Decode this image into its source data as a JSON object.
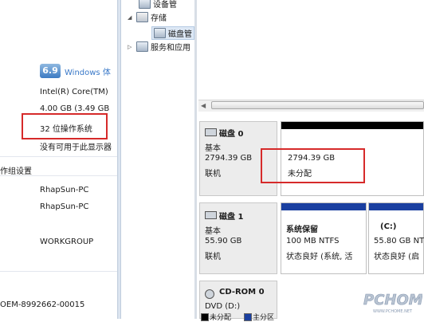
{
  "system": {
    "rating": "6.9",
    "rating_label": "Windows 体",
    "processor": "Intel(R) Core(TM)",
    "memory": "4.00 GB (3.49 GB",
    "system_type": "32 位操作系统",
    "pen_touch": "没有可用于此显示器",
    "workgroup_settings": "作组设置",
    "computer_name": "RhapSun-PC",
    "full_name": "RhapSun-PC",
    "workgroup": "WORKGROUP",
    "product_id": "OEM-8992662-00015"
  },
  "tree": {
    "items": [
      {
        "label": "设备管"
      },
      {
        "label": "存储"
      },
      {
        "label": "磁盘管"
      },
      {
        "label": "服务和应用"
      }
    ]
  },
  "disks": [
    {
      "title": "磁盘 0",
      "type": "基本",
      "size": "2794.39 GB",
      "status": "联机"
    },
    {
      "title": "磁盘 1",
      "type": "基本",
      "size": "55.90 GB",
      "status": "联机"
    },
    {
      "title": "CD-ROM 0",
      "type": "DVD (D:)"
    }
  ],
  "unallocated": {
    "size": "2794.39 GB",
    "label": "未分配"
  },
  "volumes": [
    {
      "name": "系统保留",
      "size": "100 MB NTFS",
      "status": "状态良好 (系统, 活"
    },
    {
      "name": "(C:)",
      "size": "55.80 GB NTF",
      "status": "状态良好 (启"
    }
  ],
  "legend": [
    {
      "label": "未分配",
      "color": "#000000"
    },
    {
      "label": "主分区",
      "color": "#1a3fa0"
    }
  ],
  "watermark": {
    "text": "PCHOME",
    "url": "WWW.PCHOME.NET"
  },
  "colors": {
    "primary_partition": "#1a3fa0",
    "unallocated": "#000000",
    "highlight": "#d62a2a"
  }
}
